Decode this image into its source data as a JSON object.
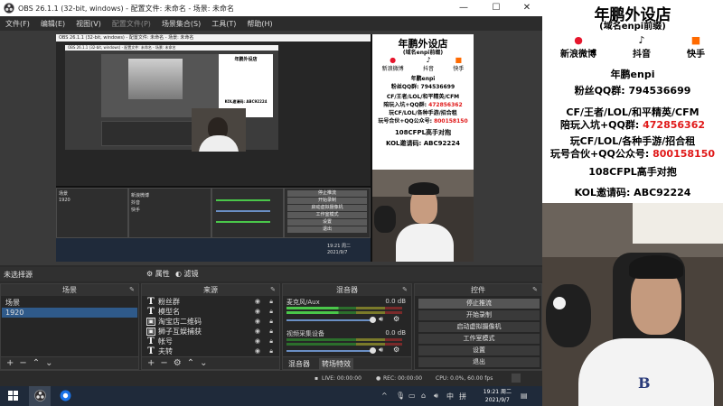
{
  "window": {
    "title": "OBS 26.1.1 (32-bit, windows) - 配置文件: 未命名 - 场景: 未命名",
    "controls": {
      "minimize": "—",
      "maximize": "☐",
      "close": "✕"
    }
  },
  "menu": [
    "文件(F)",
    "编辑(E)",
    "视图(V)",
    "配置文件(P)",
    "场景集合(S)",
    "工具(T)",
    "帮助(H)"
  ],
  "nested": {
    "title": "OBS 26.1.1 (32-bit, windows) - 配置文件: 未命名 - 场景: 未命名",
    "scene_label": "场景",
    "scene_item": "1920",
    "src_labels": [
      "新浪微博",
      "抖音",
      "快手",
      "年鹏外设店",
      "KOL邀请码: ABC92224"
    ],
    "controls": [
      "停止推流",
      "开始录制",
      "启动虚拟摄像机",
      "工作室模式",
      "设置",
      "退出"
    ],
    "inner_title": "OBS 26.1.1 (32-bit, windows) - 配置文件: 未命名 - 场景: 未命名",
    "clock": [
      "19:21 周二",
      "2021/9/7"
    ]
  },
  "poster": {
    "title": "年鹏外设店",
    "subtitle": "(域名enpi前缀)",
    "socials": [
      {
        "icon": "weibo-icon",
        "label": "新浪微博"
      },
      {
        "icon": "douyin-icon",
        "label": "抖音"
      },
      {
        "icon": "kuaishou-icon",
        "label": "快手"
      }
    ],
    "handle": "年鹏enpi",
    "fans_qq": "粉丝QQ群: 794536699",
    "line1": "CF/王者/LOL/和平精英/CFM",
    "line2_prefix": "陪玩入坑+QQ群: ",
    "line2_num": "472856362",
    "line3": "玩CF/LOL/各种手游/招合租",
    "line4_prefix": "玩号合伙+QQ公众号: ",
    "line4_num": "800158150",
    "line5": "108CFPL高手对抱",
    "line6": "KOL邀请码: ABC92224"
  },
  "status_header": {
    "label": "未选择源",
    "props": "属性",
    "filters": "滤镜"
  },
  "docks": {
    "scenes": {
      "title": "场景",
      "items": [
        "场景",
        "1920"
      ]
    },
    "sources": {
      "title": "来源",
      "items": [
        {
          "icon": "text-icon",
          "glyph": "T",
          "label": "粉丝群"
        },
        {
          "icon": "text-icon",
          "glyph": "T",
          "label": "模型名"
        },
        {
          "icon": "image-icon",
          "glyph": "▣",
          "label": "淘宝店二维码"
        },
        {
          "icon": "image-icon",
          "glyph": "▣",
          "label": "狮子互娱捕获"
        },
        {
          "icon": "text-icon",
          "glyph": "T",
          "label": "帐号"
        },
        {
          "icon": "text-icon",
          "glyph": "T",
          "label": "夫转"
        }
      ]
    },
    "mixer": {
      "title": "混音器",
      "channels": [
        {
          "label": "麦克风/Aux",
          "db": "0.0 dB"
        },
        {
          "label": "视频采集设备",
          "db": "0.0 dB"
        }
      ],
      "tabs": [
        "混音器",
        "转场特效"
      ]
    },
    "transitions": {
      "title": "转场特效"
    },
    "controls": {
      "title": "控件",
      "buttons": [
        "停止推流",
        "开始录制",
        "启动虚拟摄像机",
        "工作室模式",
        "设置",
        "退出"
      ]
    }
  },
  "status": {
    "live": "LIVE: 00:00:00",
    "rec": "REC: 00:00:00",
    "cpu": "CPU: 0.0%, 60.00 fps"
  },
  "taskbar": {
    "time": "19:21 周二",
    "date": "2021/9/7"
  },
  "right_poster": {
    "title": "年鹏外设店",
    "subtitle": "(域名enpi前缀)",
    "socials": [
      "新浪微博",
      "抖音",
      "快手"
    ],
    "handle": "年鹏enpi",
    "fans_qq": "粉丝QQ群: 794536699",
    "line1": "CF/王者/LOL/和平精英/CFM",
    "line2_prefix": "陪玩入坑+QQ群: ",
    "line2_num": "472856362",
    "line3": "玩CF/LOL/各种手游/招合租",
    "line4_prefix": "玩号合伙+QQ公众号: ",
    "line4_num": "800158150",
    "line5": "108CFPL高手对抱",
    "line6": "KOL邀请码: ABC92224"
  }
}
